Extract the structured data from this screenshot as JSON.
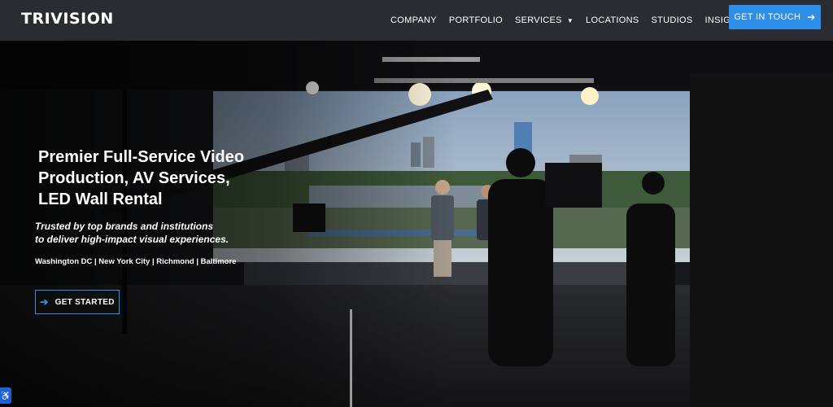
{
  "header": {
    "logo_text": "TRIVISION",
    "nav": [
      {
        "label": "COMPANY"
      },
      {
        "label": "PORTFOLIO"
      },
      {
        "label": "SERVICES"
      },
      {
        "label": "LOCATIONS"
      },
      {
        "label": "STUDIOS"
      },
      {
        "label": "INSIGHTS"
      }
    ],
    "cta_label": "GET IN TOUCH"
  },
  "hero": {
    "headline": [
      "Premier Full-Service Video",
      "Production, AV Services,",
      "LED Wall Rental"
    ],
    "tagline": [
      "Trusted by top brands and institutions",
      "to deliver high-impact visual experiences."
    ],
    "locations": "Washington DC | New York City | Richmond | Baltimore",
    "button_label": "GET STARTED"
  },
  "icons": {
    "nav_dropdown": "chevron-down-icon",
    "cta_arrow": "arrow-right-icon",
    "start_arrow": "arrow-right-icon",
    "accessibility": "accessibility-icon"
  },
  "colors": {
    "header_bg": "#2b2c31",
    "accent": "#2f8fe8",
    "text": "#ffffff"
  }
}
